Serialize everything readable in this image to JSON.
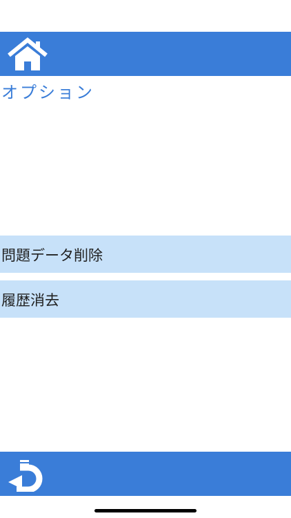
{
  "header": {
    "home_icon": "home-icon"
  },
  "page": {
    "title": "オプション"
  },
  "options": [
    {
      "label": "問題データ削除"
    },
    {
      "label": "履歴消去"
    }
  ],
  "footer": {
    "back_icon": "back-arrow-icon"
  },
  "colors": {
    "bar": "#3a7dd8",
    "item_background": "#c7e1f9",
    "title_text": "#3a7dd8",
    "item_text": "#222222"
  }
}
